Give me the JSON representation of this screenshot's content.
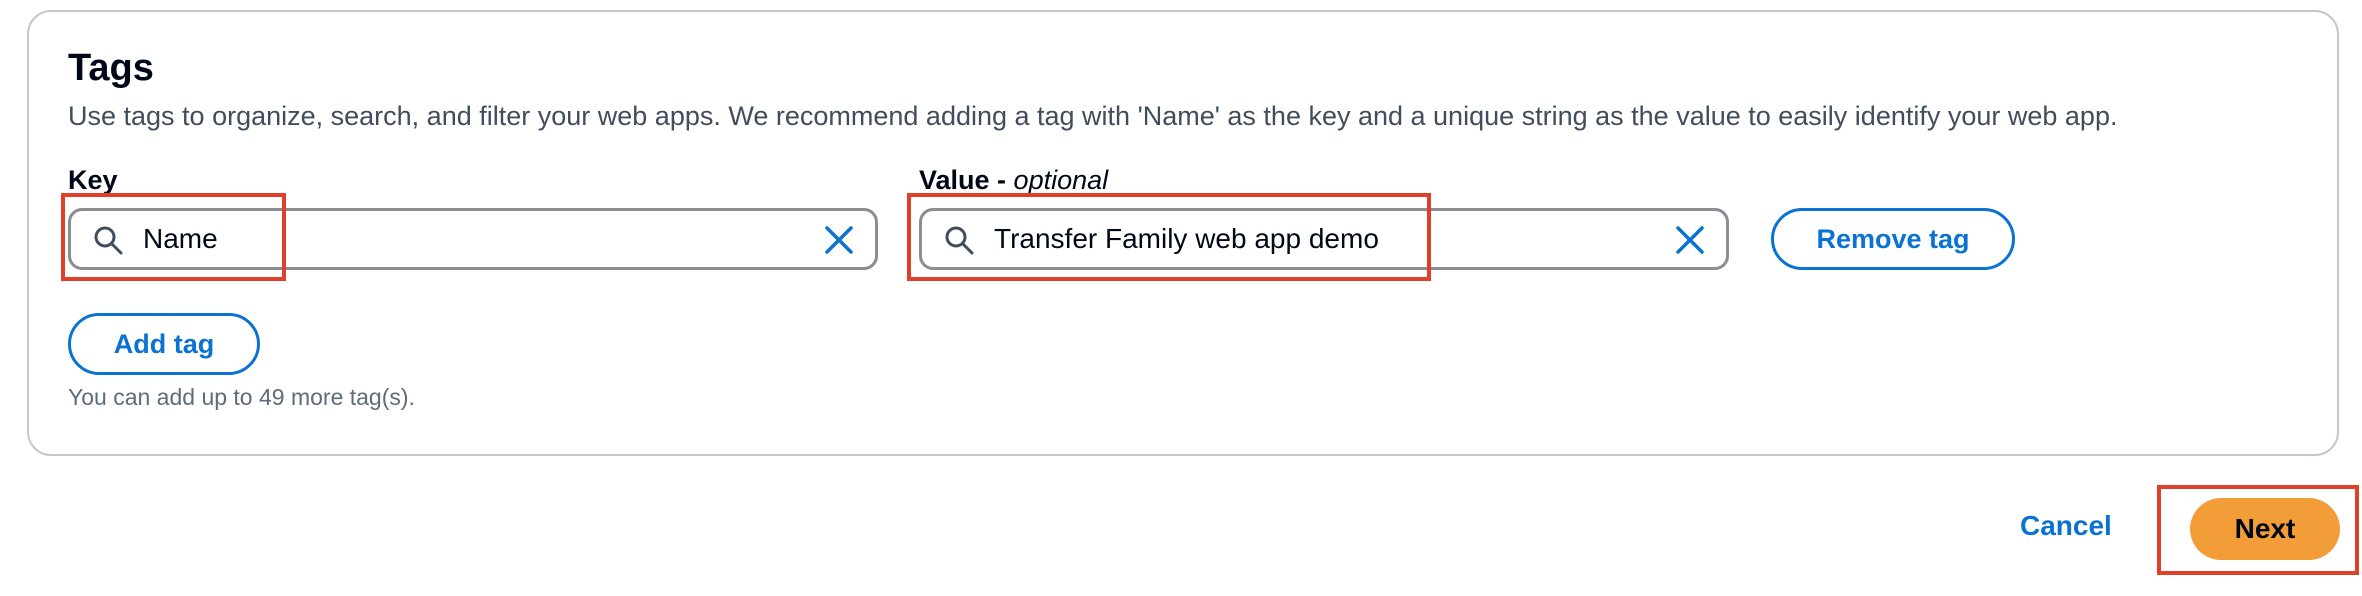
{
  "tags": {
    "title": "Tags",
    "description": "Use tags to organize, search, and filter your web apps. We recommend adding a tag with 'Name' as the key and a unique string as the value to easily identify your web app.",
    "key_label": "Key",
    "value_label": "Value - ",
    "value_label_optional": "optional",
    "key_value": "Name",
    "value_value": "Transfer Family web app demo",
    "remove_tag_label": "Remove tag",
    "add_tag_label": "Add tag",
    "hint": "You can add up to 49 more tag(s)."
  },
  "footer": {
    "cancel_label": "Cancel",
    "next_label": "Next"
  },
  "colors": {
    "accent": "#0972d3",
    "primary_button": "#f29d38",
    "highlight": "#e0402a"
  },
  "icons": [
    "search-icon",
    "clear-icon"
  ]
}
